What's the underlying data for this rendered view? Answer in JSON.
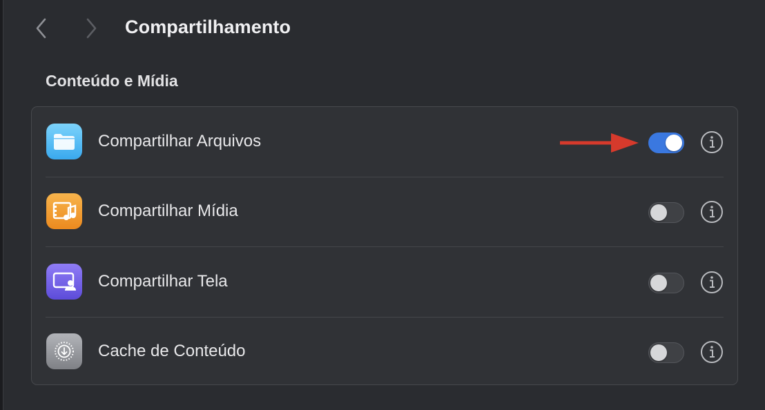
{
  "header": {
    "title": "Compartilhamento",
    "back_icon": "chevron-left-icon",
    "forward_icon": "chevron-right-icon"
  },
  "section": {
    "title": "Conteúdo e Mídia"
  },
  "items": [
    {
      "label": "Compartilhar Arquivos",
      "icon": "folder-icon",
      "enabled": true
    },
    {
      "label": "Compartilhar Mídia",
      "icon": "film-music-icon",
      "enabled": false
    },
    {
      "label": "Compartilhar Tela",
      "icon": "screen-share-icon",
      "enabled": false
    },
    {
      "label": "Cache de Conteúdo",
      "icon": "download-circle-icon",
      "enabled": false
    }
  ],
  "colors": {
    "background": "#2a2c30",
    "card": "#303236",
    "toggle_on": "#3a78e0",
    "annotation_arrow": "#d63a2c"
  }
}
